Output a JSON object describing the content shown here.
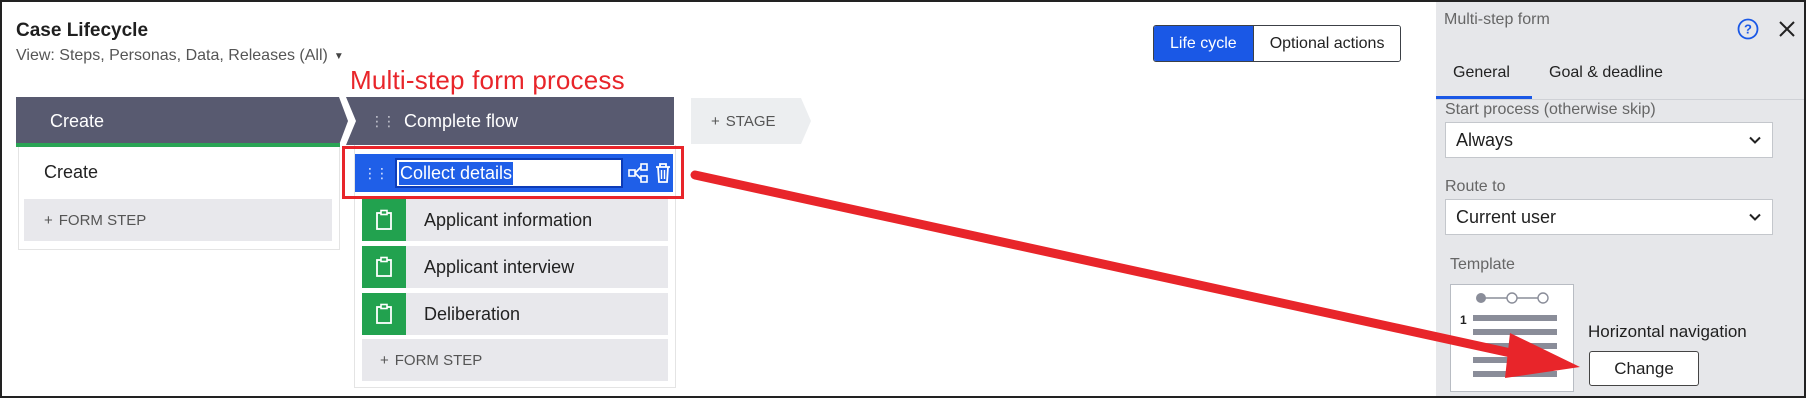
{
  "header": {
    "title": "Case Lifecycle",
    "view_label": "View: Steps, Personas, Data, Releases (All)"
  },
  "view_toggle": {
    "options": [
      "Life cycle",
      "Optional actions"
    ],
    "selected": "Life cycle"
  },
  "annotation": {
    "text": "Multi-step form process",
    "color": "#e8252a"
  },
  "stages": [
    {
      "name": "Create",
      "steps": [
        "Create"
      ],
      "add_step_label": "FORM STEP"
    },
    {
      "name": "Complete flow",
      "selected_process": "Collect details",
      "steps": [
        "Applicant information",
        "Applicant interview",
        "Deliberation"
      ],
      "add_step_label": "FORM STEP"
    }
  ],
  "add_stage_label": "STAGE",
  "panel": {
    "title": "Multi-step form",
    "tabs": [
      "General",
      "Goal & deadline"
    ],
    "active_tab": "General",
    "start_process": {
      "label": "Start process (otherwise skip)",
      "value": "Always"
    },
    "route_to": {
      "label": "Route to",
      "value": "Current user"
    },
    "template": {
      "label": "Template",
      "name": "Horizontal navigation",
      "thumbnail_step_number": "1",
      "change_label": "Change"
    }
  },
  "colors": {
    "stage_bg": "#585a70",
    "accent_blue": "#1a58e6",
    "step_green": "#22a24f"
  }
}
